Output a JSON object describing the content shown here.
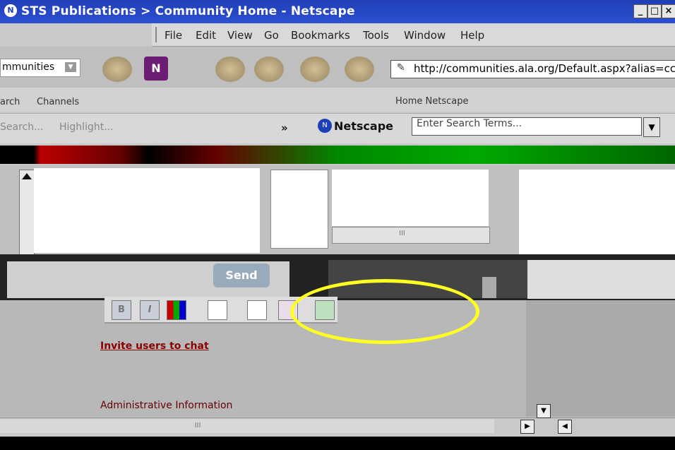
{
  "window": {
    "title": "STS Publications > Community Home - Netscape",
    "controls": [
      "_",
      "□",
      "×"
    ]
  },
  "menu": [
    "File",
    "Edit",
    "View",
    "Go",
    "Bookmarks",
    "Tools",
    "Window",
    "Help"
  ],
  "toolbar": {
    "communities_dropdown": "mmunities",
    "url": "http://communities.ala.org/Default.aspx?alias=cc"
  },
  "tabs_row": {
    "search_tab": "arch",
    "channels_tab": "Channels",
    "personal_bar": "Home  Netscape"
  },
  "search_row": {
    "search_placeholder": "Search...",
    "highlight_label": "Highlight...",
    "more_chevron": "»",
    "netscape_label": "Netscape",
    "enter_search_placeholder": "Enter Search Terms..."
  },
  "chat": {
    "send_label": "Send"
  },
  "format_buttons": [
    "B",
    "I",
    "",
    "",
    "",
    "",
    ""
  ],
  "links": {
    "invite": "Invite users to chat",
    "admin": "Administrative Information"
  },
  "scroll": {
    "bottom_thumb": "III",
    "pane_thumb": "III"
  }
}
